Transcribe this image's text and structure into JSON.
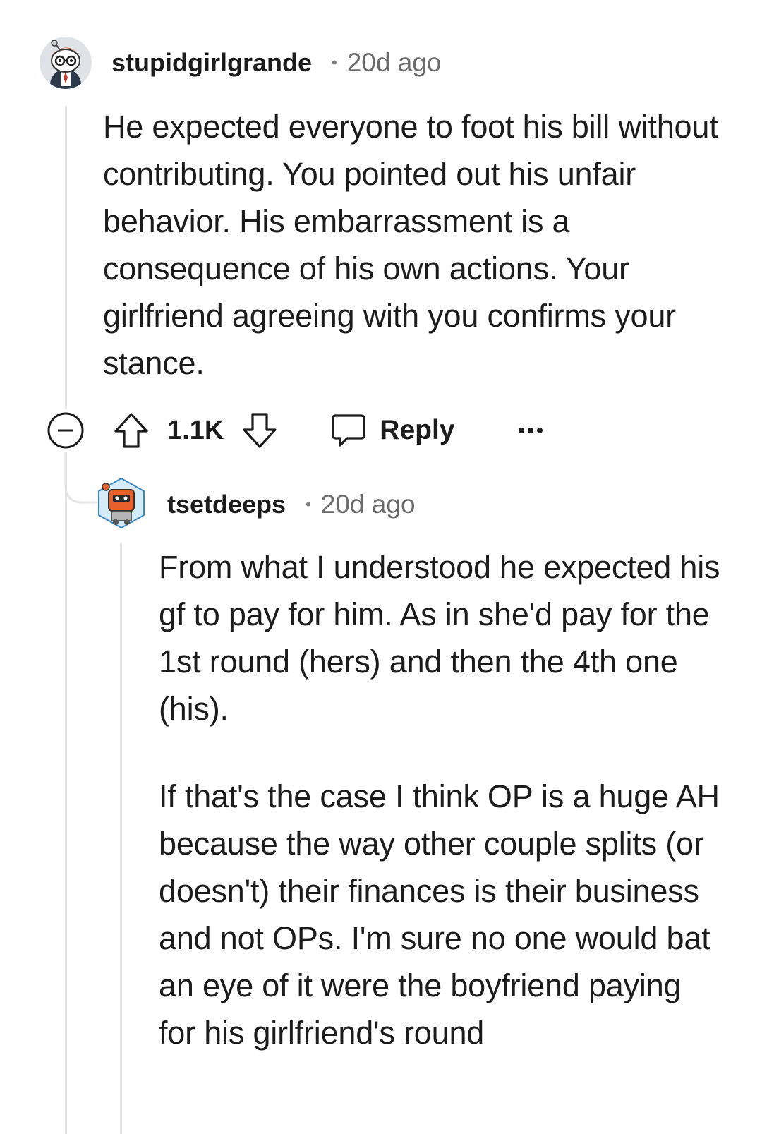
{
  "comment1": {
    "username": "stupidgirlgrande",
    "separator": "•",
    "time": "20d ago",
    "body": "He expected everyone to foot his bill without contributing. You pointed out his unfair behavior. His embarrassment is a consequence of his own actions. Your girlfriend agreeing with you confirms your stance.",
    "actions": {
      "vote_count": "1.1K",
      "reply_label": "Reply",
      "more_label": "•••"
    },
    "icons": {
      "collapse": "minus-circle-icon",
      "upvote": "arrow-up-outline-icon",
      "downvote": "arrow-down-outline-icon",
      "reply": "chat-bubble-icon",
      "more": "ellipsis-icon"
    }
  },
  "comment2": {
    "username": "tsetdeeps",
    "separator": "•",
    "time": "20d ago",
    "paragraphs": [
      "From what I understood he expected his gf to pay for him. As in she'd pay for the 1st round (hers) and then the 4th one (his).",
      "If that's the case I think OP is a huge AH because the way other couple splits (or doesn't) their finances is their business and not OPs. I'm sure no one would bat an eye of it were the boyfriend paying for his girlfriend's round"
    ]
  },
  "colors": {
    "text": "#1c1c1c",
    "meta": "#6a6a6a",
    "thread_line": "#e5e5e5",
    "background": "#ffffff"
  }
}
